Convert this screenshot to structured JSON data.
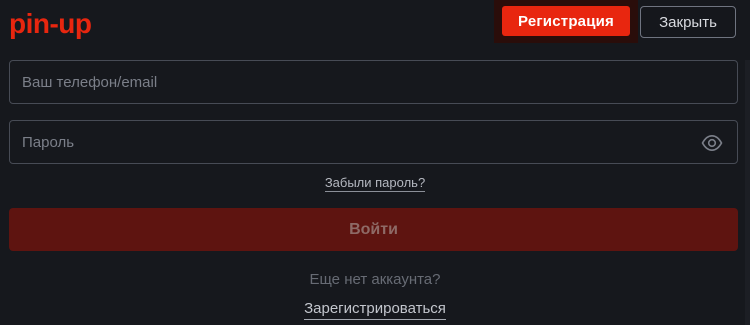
{
  "header": {
    "logo_text": "pin-up",
    "register_label": "Регистрация",
    "close_label": "Закрыть"
  },
  "colors": {
    "background": "#16181d",
    "accent": "#e8260f",
    "login_button": "#5e1410"
  },
  "form": {
    "phone_placeholder": "Ваш телефон/email",
    "password_placeholder": "Пароль",
    "password_toggle_icon": "eye-icon",
    "forgot_label": "Забыли пароль?",
    "login_label": "Войти"
  },
  "footer": {
    "no_account_text": "Еще нет аккаунта?",
    "register_link_label": "Зарегистрироваться"
  }
}
